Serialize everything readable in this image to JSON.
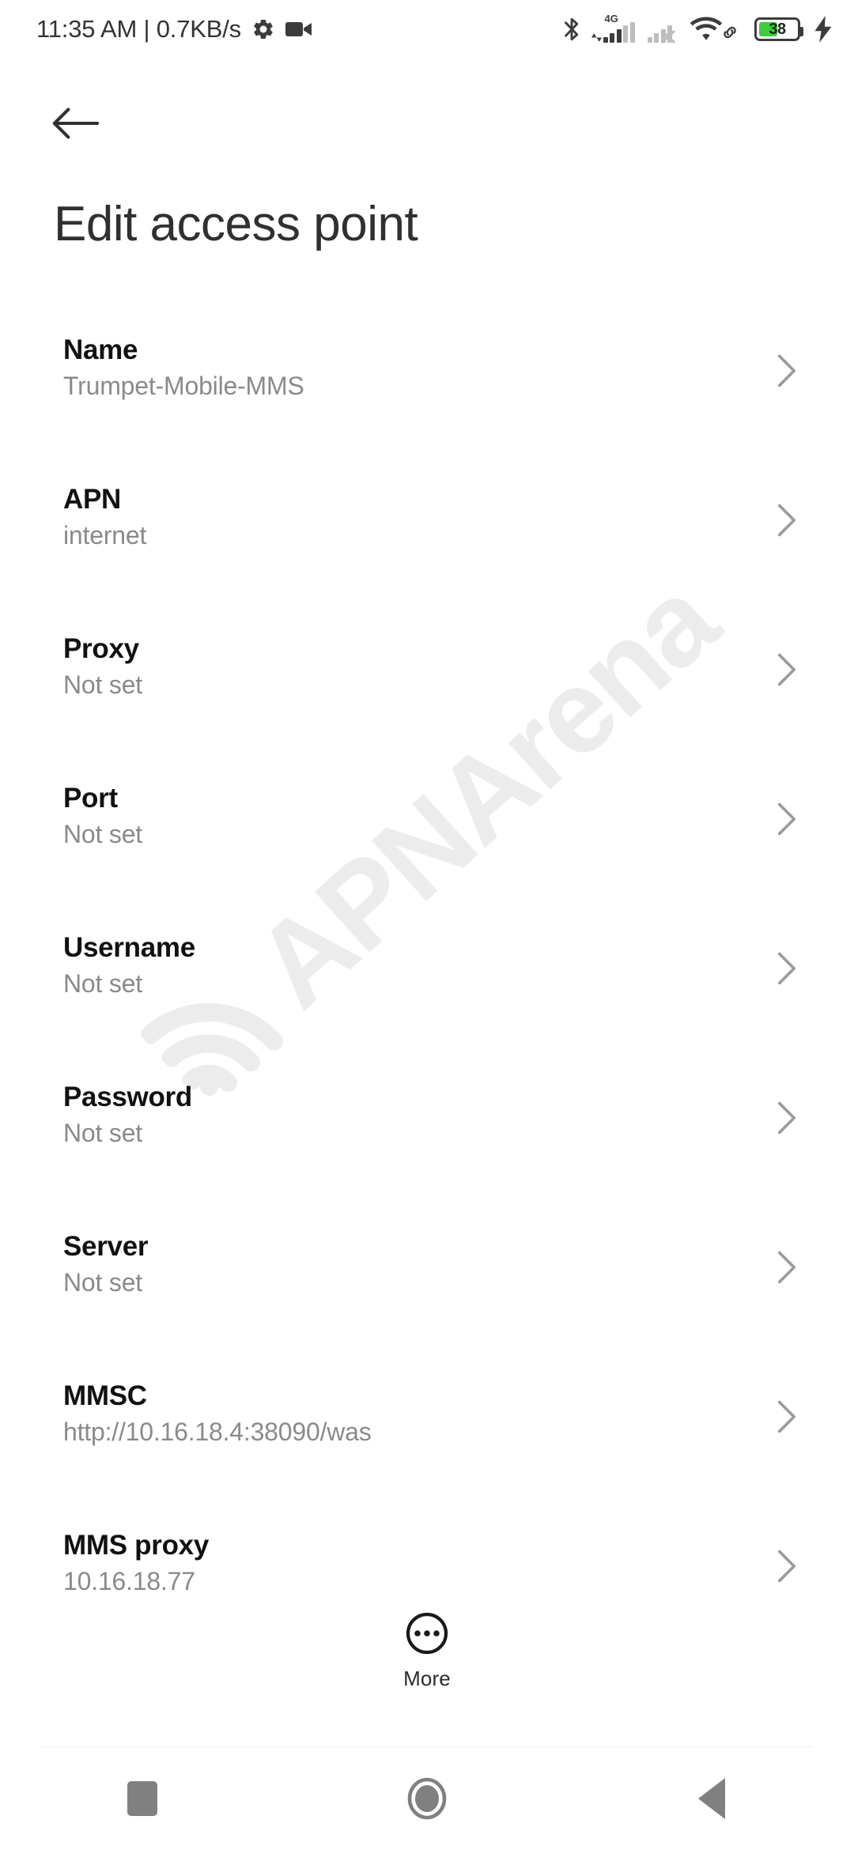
{
  "status_bar": {
    "clock": "11:35 AM | 0.7KB/s",
    "icons_left": [
      "gear-icon",
      "video-camera-icon"
    ],
    "bluetooth": "bluetooth-icon",
    "network_type": "4G",
    "sim1_bars": 3,
    "sim1_bars_total": 5,
    "sim2_bars": 2,
    "sim2_bars_total": 4,
    "sim2_state": "no-service",
    "wifi": "wifi-icon",
    "wifi_link": "link-icon",
    "battery_level": "38",
    "battery_percent": 38,
    "battery_color": "#3ccc3c",
    "charging": true
  },
  "app_bar": {
    "back_label": "back-arrow",
    "title": "Edit access point"
  },
  "watermark": {
    "text": "APNArena",
    "color": "#ececec"
  },
  "settings": {
    "rows": [
      {
        "label": "Name",
        "value": "Trumpet-Mobile-MMS"
      },
      {
        "label": "APN",
        "value": "internet"
      },
      {
        "label": "Proxy",
        "value": "Not set"
      },
      {
        "label": "Port",
        "value": "Not set"
      },
      {
        "label": "Username",
        "value": "Not set"
      },
      {
        "label": "Password",
        "value": "Not set"
      },
      {
        "label": "Server",
        "value": "Not set"
      },
      {
        "label": "MMSC",
        "value": "http://10.16.18.4:38090/was"
      },
      {
        "label": "MMS proxy",
        "value": "10.16.18.77"
      }
    ]
  },
  "more_button": {
    "label": "More",
    "icon": "overflow-circle-icon"
  },
  "nav_bar": {
    "recents_label": "recents",
    "home_label": "home",
    "back_label": "back",
    "color": "#808080"
  }
}
